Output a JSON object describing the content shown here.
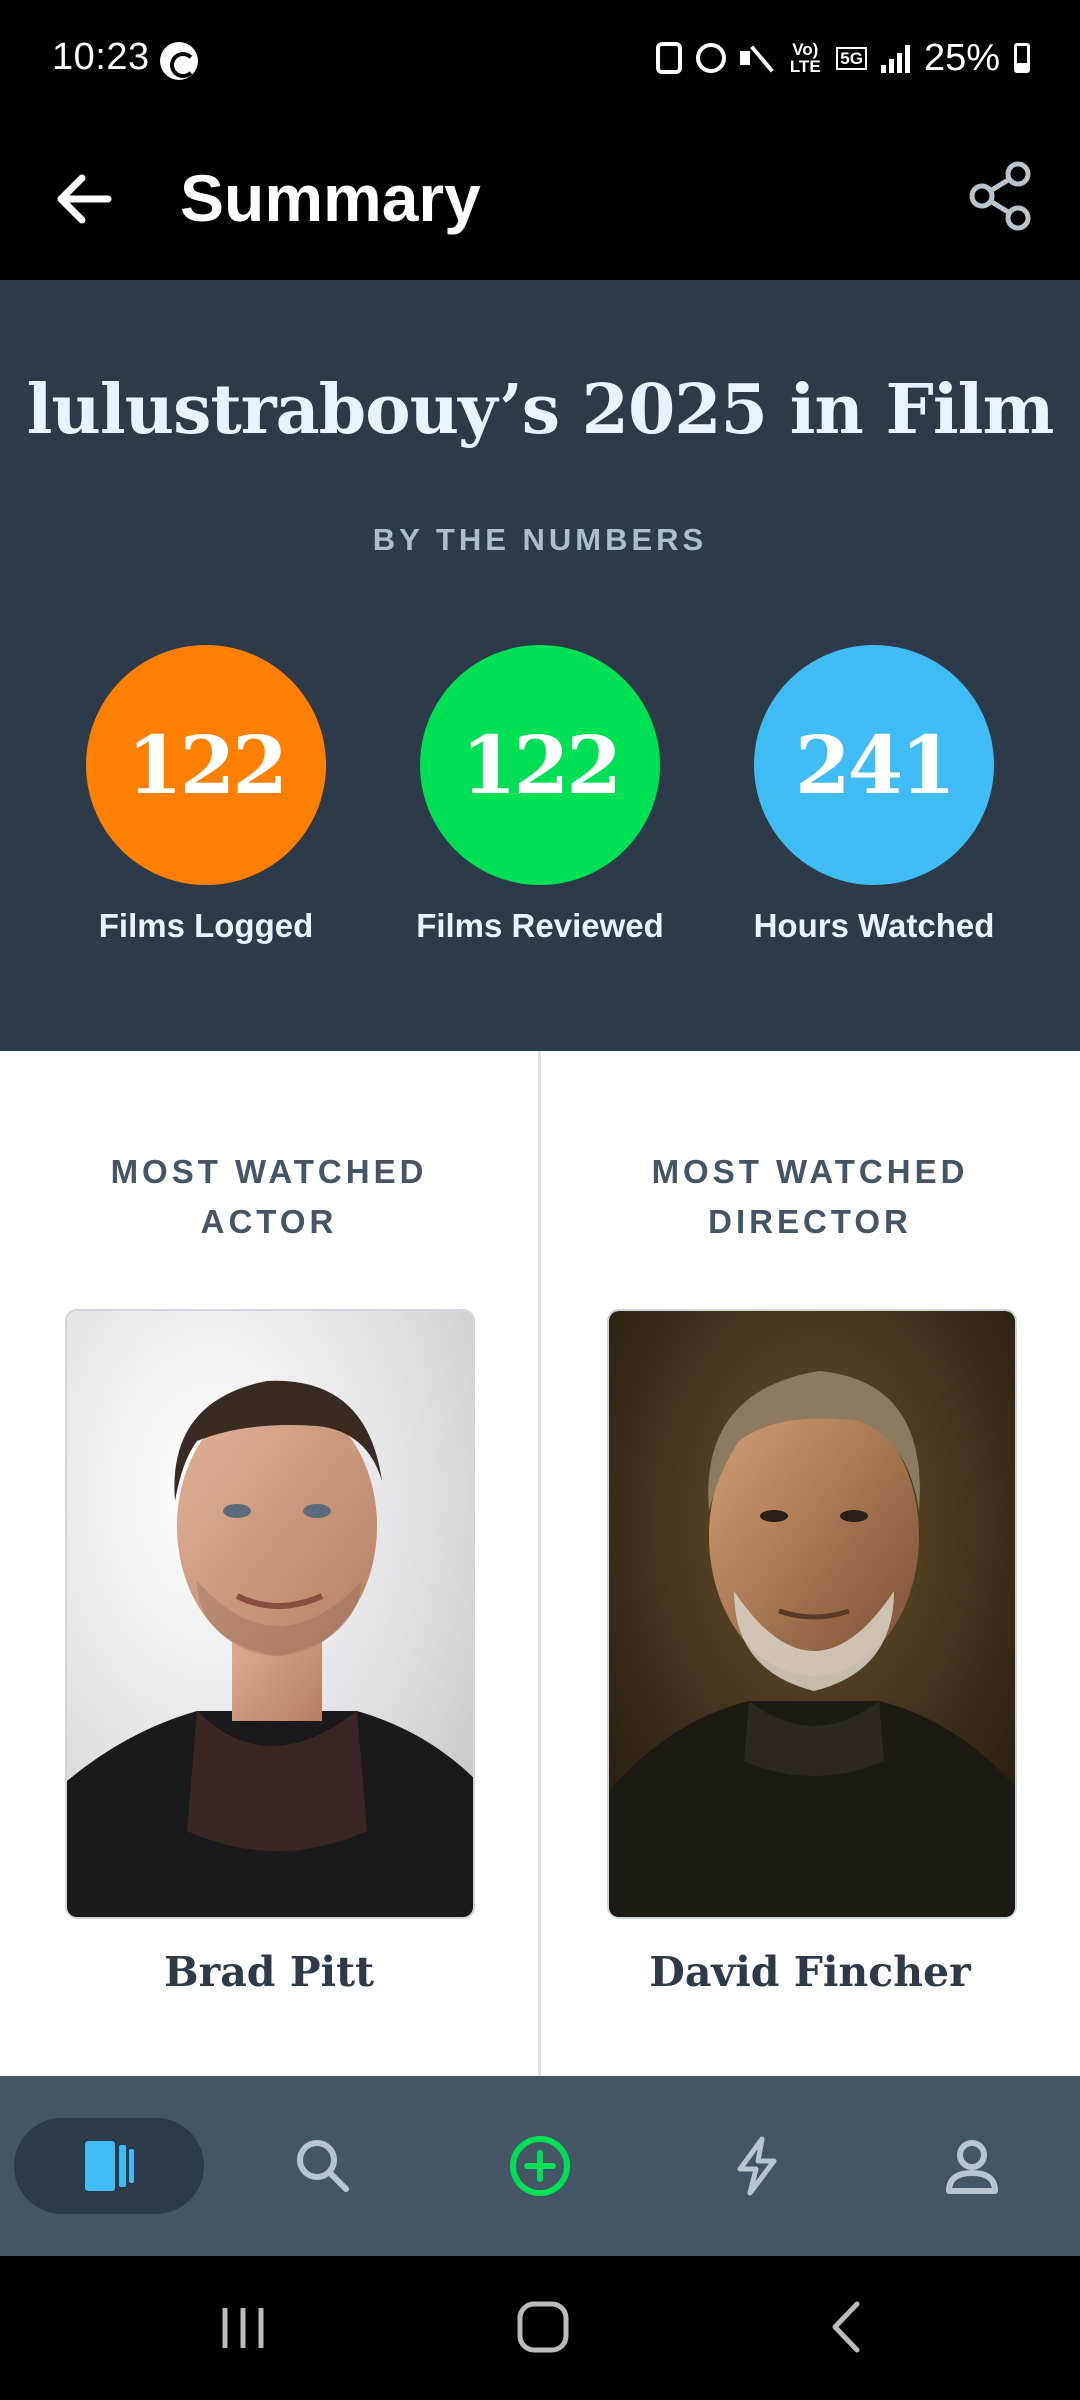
{
  "status_bar": {
    "time": "10:23",
    "network_label": "Vo) LTE",
    "network_5g": "5G",
    "battery": "25%"
  },
  "app_bar": {
    "title": "Summary",
    "back_icon": "arrow-left-icon",
    "share_icon": "share-icon"
  },
  "summary": {
    "title": "lulustrabouy’s 2025 in Film",
    "section_heading": "BY THE NUMBERS",
    "stats": [
      {
        "value": "122",
        "label": "Films Logged",
        "color": "#ff8000"
      },
      {
        "value": "122",
        "label": "Films Reviewed",
        "color": "#00e054"
      },
      {
        "value": "241",
        "label": "Hours Watched",
        "color": "#40bcf4"
      }
    ]
  },
  "most_watched": {
    "actor": {
      "heading": "MOST WATCHED ACTOR",
      "name": "Brad Pitt"
    },
    "director": {
      "heading": "MOST WATCHED DIRECTOR",
      "name": "David Fincher"
    }
  },
  "bottom_nav": {
    "items": [
      {
        "icon": "films-icon",
        "active": true
      },
      {
        "icon": "search-icon",
        "active": false
      },
      {
        "icon": "add-icon",
        "active": false
      },
      {
        "icon": "activity-icon",
        "active": false
      },
      {
        "icon": "profile-icon",
        "active": false
      }
    ]
  },
  "colors": {
    "background_dark": "#2c3a49",
    "nav_background": "#445566",
    "accent_blue": "#40bcf4",
    "accent_green": "#00e054",
    "accent_orange": "#ff8000"
  }
}
